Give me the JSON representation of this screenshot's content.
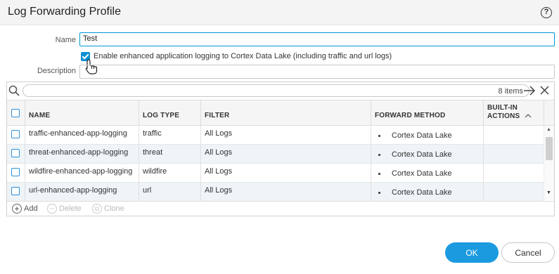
{
  "dialog": {
    "title": "Log Forwarding Profile",
    "help_glyph": "?"
  },
  "form": {
    "name_label": "Name",
    "name_value": "Test",
    "enhanced_logging_label": "Enable enhanced application logging to Cortex Data Lake (including traffic and url logs)",
    "enhanced_logging_checked": true,
    "description_label": "Description",
    "description_value": ""
  },
  "grid": {
    "items_count": "8 items",
    "columns": [
      "NAME",
      "LOG TYPE",
      "FILTER",
      "FORWARD METHOD",
      "BUILT-IN ACTIONS"
    ],
    "rows": [
      {
        "name": "traffic-enhanced-app-logging",
        "log_type": "traffic",
        "filter": "All Logs",
        "forward_method": "Cortex Data Lake",
        "builtin_actions": ""
      },
      {
        "name": "threat-enhanced-app-logging",
        "log_type": "threat",
        "filter": "All Logs",
        "forward_method": "Cortex Data Lake",
        "builtin_actions": ""
      },
      {
        "name": "wildfire-enhanced-app-logging",
        "log_type": "wildfire",
        "filter": "All Logs",
        "forward_method": "Cortex Data Lake",
        "builtin_actions": ""
      },
      {
        "name": "url-enhanced-app-logging",
        "log_type": "url",
        "filter": "All Logs",
        "forward_method": "Cortex Data Lake",
        "builtin_actions": ""
      }
    ],
    "footer": {
      "add": "Add",
      "delete": "Delete",
      "clone": "Clone"
    }
  },
  "buttons": {
    "ok": "OK",
    "cancel": "Cancel"
  },
  "colors": {
    "accent": "#1b9ae0",
    "checkbox": "#2f8fd6",
    "row_alt": "#eef4f7"
  },
  "icons": [
    "help-icon",
    "search-icon",
    "arrow-right-icon",
    "close-icon",
    "sort-up-icon",
    "add-icon",
    "delete-icon",
    "clone-icon",
    "hand-cursor-icon"
  ]
}
